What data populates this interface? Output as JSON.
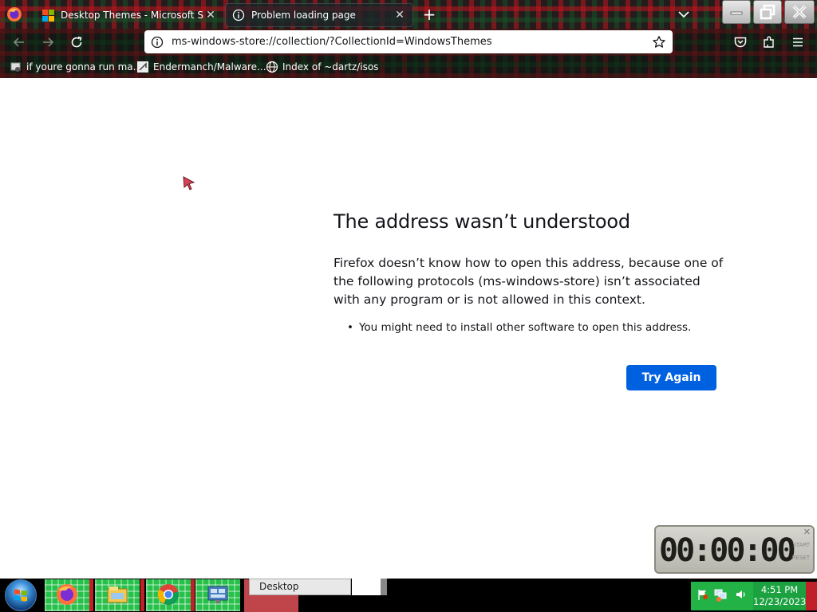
{
  "browser": {
    "tabs": [
      {
        "title": "Desktop Themes - Microsoft Supp",
        "icon": "microsoft-logo-icon",
        "close": "✕"
      },
      {
        "title": "Problem loading page",
        "icon": "info-icon",
        "close": "✕"
      }
    ],
    "new_tab": "+",
    "address": "ms-windows-store://collection/?CollectionId=WindowsThemes",
    "bookmarks": [
      {
        "label": "if youre gonna run ma...",
        "icon": "bookmark-site-icon"
      },
      {
        "label": "Endermanch/Malware...",
        "icon": "bookmark-site-icon"
      },
      {
        "label": "Index of ~dartz/isos",
        "icon": "globe-icon"
      }
    ],
    "colors": {
      "accent": "#0061e0",
      "theme": "tartan-red-green"
    }
  },
  "error_page": {
    "title": "The address wasn’t understood",
    "description": "Firefox doesn’t know how to open this address, because one of the following protocols (ms-windows-store) isn’t associated with any program or is not allowed in this context.",
    "items": [
      "You might need to install other software to open this address."
    ],
    "try_again": "Try Again"
  },
  "stopwatch": {
    "time": "00:00:00",
    "start": "START",
    "reset": "RESET",
    "close": "✕"
  },
  "taskbar": {
    "tooltip": "Desktop",
    "clock_time": "4:51 PM",
    "clock_date": "12/23/2023",
    "pinned": [
      "firefox-icon",
      "explorer-icon",
      "chrome-icon",
      "control-panel-icon"
    ]
  }
}
